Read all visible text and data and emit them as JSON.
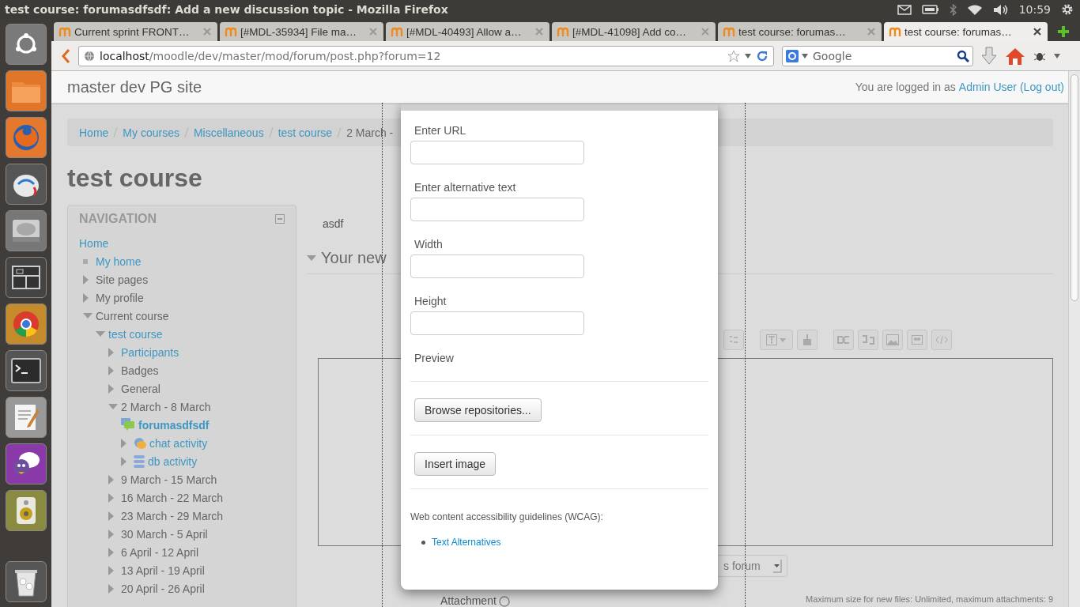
{
  "os_panel": {
    "title": "test course: forumasdfsdf: Add a new discussion topic - Mozilla Firefox",
    "time": "10:59"
  },
  "tabs": [
    {
      "label": "Current sprint FRONT…",
      "selected": false
    },
    {
      "label": "[#MDL-35934] File ma…",
      "selected": false
    },
    {
      "label": "[#MDL-40493] Allow a…",
      "selected": false
    },
    {
      "label": "[#MDL-41098] Add co…",
      "selected": false
    },
    {
      "label": "test course: forumas…",
      "selected": false
    },
    {
      "label": "test course: forumas…",
      "selected": true
    }
  ],
  "address_bar": {
    "host": "localhost",
    "path": "/moodle/dev/master/mod/forum/post.php?forum=12"
  },
  "search": {
    "placeholder": "Google"
  },
  "site": {
    "name": "master dev PG site",
    "login_prefix": "You are logged in as",
    "user": "Admin User",
    "logout": "(Log out)"
  },
  "breadcrumb": [
    {
      "label": "Home",
      "link": true
    },
    {
      "label": "My courses",
      "link": true
    },
    {
      "label": "Miscellaneous",
      "link": true
    },
    {
      "label": "test course",
      "link": true
    },
    {
      "label": "2 March -",
      "link": false
    }
  ],
  "course_title": "test course",
  "navigation": {
    "title": "NAVIGATION",
    "items": [
      {
        "label": "Home",
        "link": true,
        "current": false,
        "children": [
          {
            "label": "My home",
            "kind": "leaf",
            "link": true,
            "current": false
          },
          {
            "label": "Site pages",
            "kind": "branch",
            "link": false,
            "expanded": false,
            "current": false
          },
          {
            "label": "My profile",
            "kind": "branch",
            "link": false,
            "expanded": false,
            "current": false
          },
          {
            "label": "Current course",
            "kind": "branch",
            "link": false,
            "expanded": true,
            "current": false,
            "children": [
              {
                "label": "test course",
                "kind": "branch",
                "link": true,
                "expanded": true,
                "current": false,
                "children": [
                  {
                    "label": "Participants",
                    "kind": "branch",
                    "link": true,
                    "expanded": false,
                    "current": false
                  },
                  {
                    "label": "Badges",
                    "kind": "branch",
                    "link": false,
                    "expanded": false,
                    "current": false
                  },
                  {
                    "label": "General",
                    "kind": "branch",
                    "link": false,
                    "expanded": false,
                    "current": false
                  },
                  {
                    "label": "2 March - 8 March",
                    "kind": "branch",
                    "link": false,
                    "expanded": true,
                    "current": false,
                    "children": [
                      {
                        "label": "forumasdfsdf",
                        "kind": "forum",
                        "link": true,
                        "current": true
                      },
                      {
                        "label": "chat activity",
                        "kind": "chat",
                        "link": true,
                        "expanded": false,
                        "current": false
                      },
                      {
                        "label": "db activity",
                        "kind": "db",
                        "link": true,
                        "expanded": false,
                        "current": false
                      }
                    ]
                  },
                  {
                    "label": "9 March - 15 March",
                    "kind": "branch",
                    "link": false,
                    "expanded": false,
                    "current": false
                  },
                  {
                    "label": "16 March - 22 March",
                    "kind": "branch",
                    "link": false,
                    "expanded": false,
                    "current": false
                  },
                  {
                    "label": "23 March - 29 March",
                    "kind": "branch",
                    "link": false,
                    "expanded": false,
                    "current": false
                  },
                  {
                    "label": "30 March - 5 April",
                    "kind": "branch",
                    "link": false,
                    "expanded": false,
                    "current": false
                  },
                  {
                    "label": "6 April - 12 April",
                    "kind": "branch",
                    "link": false,
                    "expanded": false,
                    "current": false
                  },
                  {
                    "label": "13 April - 19 April",
                    "kind": "branch",
                    "link": false,
                    "expanded": false,
                    "current": false
                  },
                  {
                    "label": "20 April - 26 April",
                    "kind": "branch",
                    "link": false,
                    "expanded": false,
                    "current": false
                  }
                ]
              }
            ]
          }
        ]
      }
    ]
  },
  "main": {
    "intro": "asdf",
    "section_title": "Your new",
    "format_select": "s forum",
    "file_limits": "Maximum size for new files: Unlimited, maximum attachments: 9",
    "attachment_label": "Attachment"
  },
  "dialog": {
    "fields": [
      {
        "label": "Enter URL"
      },
      {
        "label": "Enter alternative text"
      },
      {
        "label": "Width"
      },
      {
        "label": "Height"
      }
    ],
    "preview_label": "Preview",
    "browse_button": "Browse repositories...",
    "insert_button": "Insert image",
    "wcag_heading": "Web content accessibility guidelines (WCAG):",
    "wcag_links": [
      "Text Alternatives"
    ]
  }
}
